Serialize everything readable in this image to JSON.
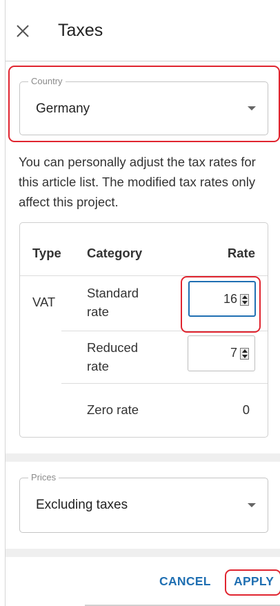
{
  "header": {
    "title": "Taxes"
  },
  "country": {
    "label": "Country",
    "value": "Germany"
  },
  "info": {
    "text": "You can personally adjust the tax rates for this article list. The modified tax rates only affect this project."
  },
  "table": {
    "headers": {
      "type": "Type",
      "category": "Category",
      "rate": "Rate"
    },
    "rows": [
      {
        "type": "VAT",
        "category": "Standard rate",
        "rate": "16"
      },
      {
        "type": "",
        "category": "Reduced rate",
        "rate": "7"
      },
      {
        "type": "",
        "category": "Zero rate",
        "rate": "0"
      }
    ]
  },
  "prices": {
    "label": "Prices",
    "value": "Excluding taxes"
  },
  "footer": {
    "cancel_label": "CANCEL",
    "apply_label": "APPLY"
  },
  "colors": {
    "accent": "#1f6fb2",
    "highlight": "#e0242f"
  }
}
